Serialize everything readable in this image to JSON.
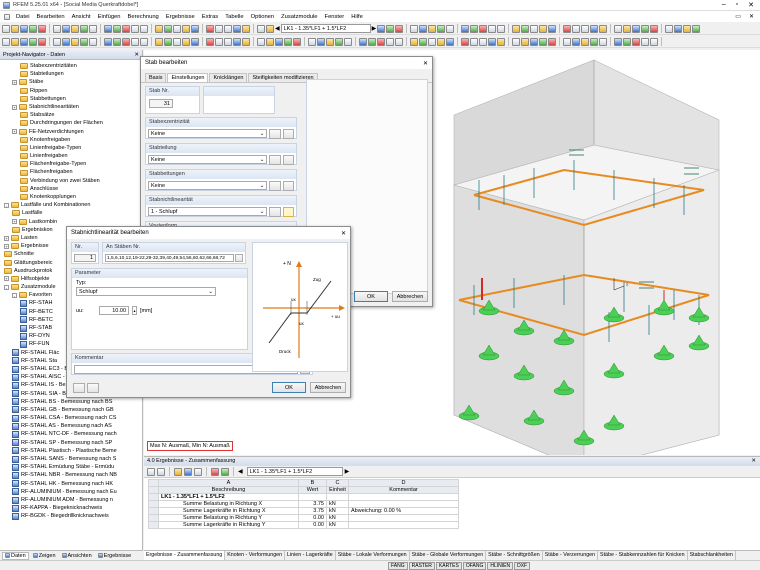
{
  "app": {
    "title": "RFEM 5.25.01 x64 - [Social Media Querkraftdobel*]"
  },
  "menu": [
    "Datei",
    "Bearbeiten",
    "Ansicht",
    "Einfügen",
    "Berechnung",
    "Ergebnisse",
    "Extras",
    "Tabelle",
    "Optionen",
    "Zusatzmodule",
    "Fenster",
    "Hilfe"
  ],
  "toolbar": {
    "loadcase": "LK1 - 1.35*LF1 + 1.5*LF2"
  },
  "navigator": {
    "title": "Projekt-Navigator - Daten",
    "items": [
      {
        "label": "Stabexzentrizitäten",
        "indent": 2,
        "icon": "folder"
      },
      {
        "label": "Stabteilungen",
        "indent": 2,
        "icon": "folder"
      },
      {
        "label": "Stäbe",
        "indent": 1,
        "icon": "folder",
        "exp": "+"
      },
      {
        "label": "Rippen",
        "indent": 2,
        "icon": "folder"
      },
      {
        "label": "Stabbettungen",
        "indent": 2,
        "icon": "folder"
      },
      {
        "label": "Stabnichtlinearitäten",
        "indent": 1,
        "icon": "folder",
        "exp": "+"
      },
      {
        "label": "Stabsätze",
        "indent": 2,
        "icon": "folder"
      },
      {
        "label": "Durchdringungen der Flächen",
        "indent": 2,
        "icon": "folder"
      },
      {
        "label": "FE-Netzverdichtungen",
        "indent": 1,
        "icon": "folder",
        "exp": "+"
      },
      {
        "label": "Knotenfreigaben",
        "indent": 2,
        "icon": "folder"
      },
      {
        "label": "Linienfreigabe-Typen",
        "indent": 2,
        "icon": "folder"
      },
      {
        "label": "Linienfreigaben",
        "indent": 2,
        "icon": "folder"
      },
      {
        "label": "Flächenfreigabe-Typen",
        "indent": 2,
        "icon": "folder"
      },
      {
        "label": "Flächenfreigaben",
        "indent": 2,
        "icon": "folder"
      },
      {
        "label": "Verbindung von zwei Stäben",
        "indent": 2,
        "icon": "folder"
      },
      {
        "label": "Anschlüsse",
        "indent": 2,
        "icon": "folder"
      },
      {
        "label": "Knotenkopplungen",
        "indent": 2,
        "icon": "folder"
      },
      {
        "label": "Lastfälle und Kombinationen",
        "indent": 0,
        "icon": "folder",
        "exp": "-"
      },
      {
        "label": "Lastfälle",
        "indent": 1,
        "icon": "folder"
      },
      {
        "label": "Lastkombin",
        "indent": 1,
        "icon": "folder",
        "exp": "+"
      },
      {
        "label": "Ergebniskon",
        "indent": 1,
        "icon": "folder"
      },
      {
        "label": "Lasten",
        "indent": 0,
        "icon": "folder",
        "exp": "+"
      },
      {
        "label": "Ergebnisse",
        "indent": 0,
        "icon": "folder",
        "exp": "+"
      },
      {
        "label": "Schnitte",
        "indent": 0,
        "icon": "folder"
      },
      {
        "label": "Glättungsbereic",
        "indent": 0,
        "icon": "folder"
      },
      {
        "label": "Ausdruckprotok",
        "indent": 0,
        "icon": "folder"
      },
      {
        "label": "Hilfsobjekte",
        "indent": 0,
        "icon": "folder",
        "exp": "+"
      },
      {
        "label": "Zusatzmodule",
        "indent": 0,
        "icon": "folder",
        "exp": "-"
      },
      {
        "label": "Favoriten",
        "indent": 1,
        "icon": "folder",
        "exp": "-"
      },
      {
        "label": "RF-STAH",
        "indent": 2,
        "icon": "module"
      },
      {
        "label": "RF-BETC",
        "indent": 2,
        "icon": "module"
      },
      {
        "label": "RF-BETC",
        "indent": 2,
        "icon": "module"
      },
      {
        "label": "RF-STAB",
        "indent": 2,
        "icon": "module"
      },
      {
        "label": "RF-DYN",
        "indent": 2,
        "icon": "module"
      },
      {
        "label": "RF-FUN",
        "indent": 2,
        "icon": "module"
      },
      {
        "label": "RF-STAHL Fläc",
        "indent": 1,
        "icon": "module"
      },
      {
        "label": "RF-STAHL Sta",
        "indent": 1,
        "icon": "module"
      },
      {
        "label": "RF-STAHL EC3 - Bemessung nach Eu",
        "indent": 1,
        "icon": "module"
      },
      {
        "label": "RF-STAHL AISC - Bemessung nach AI",
        "indent": 1,
        "icon": "module"
      },
      {
        "label": "RF-STAHL IS - Bemessung nach IS",
        "indent": 1,
        "icon": "module"
      },
      {
        "label": "RF-STAHL SIA - Bemessung nach SIA",
        "indent": 1,
        "icon": "module"
      },
      {
        "label": "RF-STAHL BS - Bemessung nach BS",
        "indent": 1,
        "icon": "module"
      },
      {
        "label": "RF-STAHL GB - Bemessung nach GB",
        "indent": 1,
        "icon": "module"
      },
      {
        "label": "RF-STAHL CSA - Bemessung nach CS",
        "indent": 1,
        "icon": "module"
      },
      {
        "label": "RF-STAHL AS - Bemessung nach AS",
        "indent": 1,
        "icon": "module"
      },
      {
        "label": "RF-STAHL NTC-DF - Bemessung nach",
        "indent": 1,
        "icon": "module"
      },
      {
        "label": "RF-STAHL SP - Bemessung nach SP",
        "indent": 1,
        "icon": "module"
      },
      {
        "label": "RF-STAHL Plastisch - Plastische Beme",
        "indent": 1,
        "icon": "module"
      },
      {
        "label": "RF-STAHL SANS - Bemessung nach S",
        "indent": 1,
        "icon": "module"
      },
      {
        "label": "RF-STAHL Ermüdung Stäbe - Ermüdu",
        "indent": 1,
        "icon": "module"
      },
      {
        "label": "RF-STAHL NBR - Bemessung nach NB",
        "indent": 1,
        "icon": "module"
      },
      {
        "label": "RF-STAHL HK - Bemessung nach HK",
        "indent": 1,
        "icon": "module"
      },
      {
        "label": "RF-ALUMINIUM - Bemessung nach Eu",
        "indent": 1,
        "icon": "module"
      },
      {
        "label": "RF-ALUMINIUM ADM - Bemessung n",
        "indent": 1,
        "icon": "module"
      },
      {
        "label": "RF-KAPPA - Biegeknicknachweis",
        "indent": 1,
        "icon": "module"
      },
      {
        "label": "RF-BGDK - Biegedrillknicknachweis",
        "indent": 1,
        "icon": "module"
      }
    ],
    "tabs": [
      "Daten",
      "Zeigen",
      "Ansichten",
      "Ergebnisse"
    ]
  },
  "stab_dialog": {
    "title": "Stab bearbeiten",
    "tabs": [
      "Basis",
      "Einstellungen",
      "Knicklängen",
      "Steifigkeiten modifizieren"
    ],
    "stab_nr_label": "Stab Nr.",
    "stab_nr": "31",
    "sections": [
      {
        "title": "Stabexzentrizität",
        "value": "Keine"
      },
      {
        "title": "Stabteilung",
        "value": "Keine"
      },
      {
        "title": "Stabbettungen",
        "value": "Keine"
      },
      {
        "title": "Stabnichtlinearität",
        "value": "1 - Schlupf"
      },
      {
        "title": "Voutenform",
        "value": ""
      }
    ],
    "ok": "OK",
    "cancel": "Abbrechen"
  },
  "nl_dialog": {
    "title": "Stabnichtlinearität bearbeiten",
    "nr_label": "Nr.",
    "nr": "1",
    "staeben_label": "An Stäben Nr.",
    "staeben": "1,5,6,10,12,19-22,29-32,39,40,49,54,56,60,62,66,68,72",
    "param_title": "Parameter",
    "typ_label": "Typ:",
    "typ": "Schlupf",
    "uu_label": "uu:",
    "uu": "10.00",
    "uu_unit": "[mm]",
    "kommentar_title": "Kommentar",
    "diagram": {
      "zug": "Zug",
      "druck": "Druck",
      "n_label": "+ N",
      "u_label": "+ uu",
      "ux1": "ux",
      "ux2": "ux"
    },
    "ok": "OK",
    "cancel": "Abbrechen"
  },
  "viewport": {
    "legend": "Max N: Ausmaß, Min N: Ausmaß"
  },
  "results": {
    "title": "4.0 Ergebnisse - Zusammenfassung",
    "loadcase": "LK1 - 1.35*LF1 + 1.5*LF2",
    "col_letters": [
      "A",
      "B",
      "C",
      "D"
    ],
    "headers": [
      "Beschreibung",
      "Wert",
      "Einheit",
      "Kommentar"
    ],
    "rows": [
      {
        "desc": "LK1 - 1.35*LF1 + 1.5*LF2",
        "val": "",
        "unit": "",
        "comment": "",
        "group": true
      },
      {
        "desc": "Summe Belastung in Richtung X",
        "val": "3.75",
        "unit": "kN",
        "comment": ""
      },
      {
        "desc": "Summe Lagerkräfte in Richtung X",
        "val": "3.75",
        "unit": "kN",
        "comment": "Abweichung: 0.00 %"
      },
      {
        "desc": "Summe Belastung in Richtung Y",
        "val": "0.00",
        "unit": "kN",
        "comment": ""
      },
      {
        "desc": "Summe Lagerkräfte in Richtung Y",
        "val": "0.00",
        "unit": "kN",
        "comment": ""
      }
    ],
    "tabs": [
      "Ergebnisse - Zusammenfassung",
      "Knoten - Verformungen",
      "Linien - Lagerkräfte",
      "Stäbe - Lokale Verformungen",
      "Stäbe - Globale Verformungen",
      "Stäbe - Schnittgrößen",
      "Stäbe - Verzerrungen",
      "Stäbe - Stabkennzahlen für Knicken",
      "Stabschlankheiten"
    ]
  },
  "status": [
    "FANG",
    "RASTER",
    "KARTES",
    "OFANG",
    "HLINIEN",
    "DXF"
  ]
}
